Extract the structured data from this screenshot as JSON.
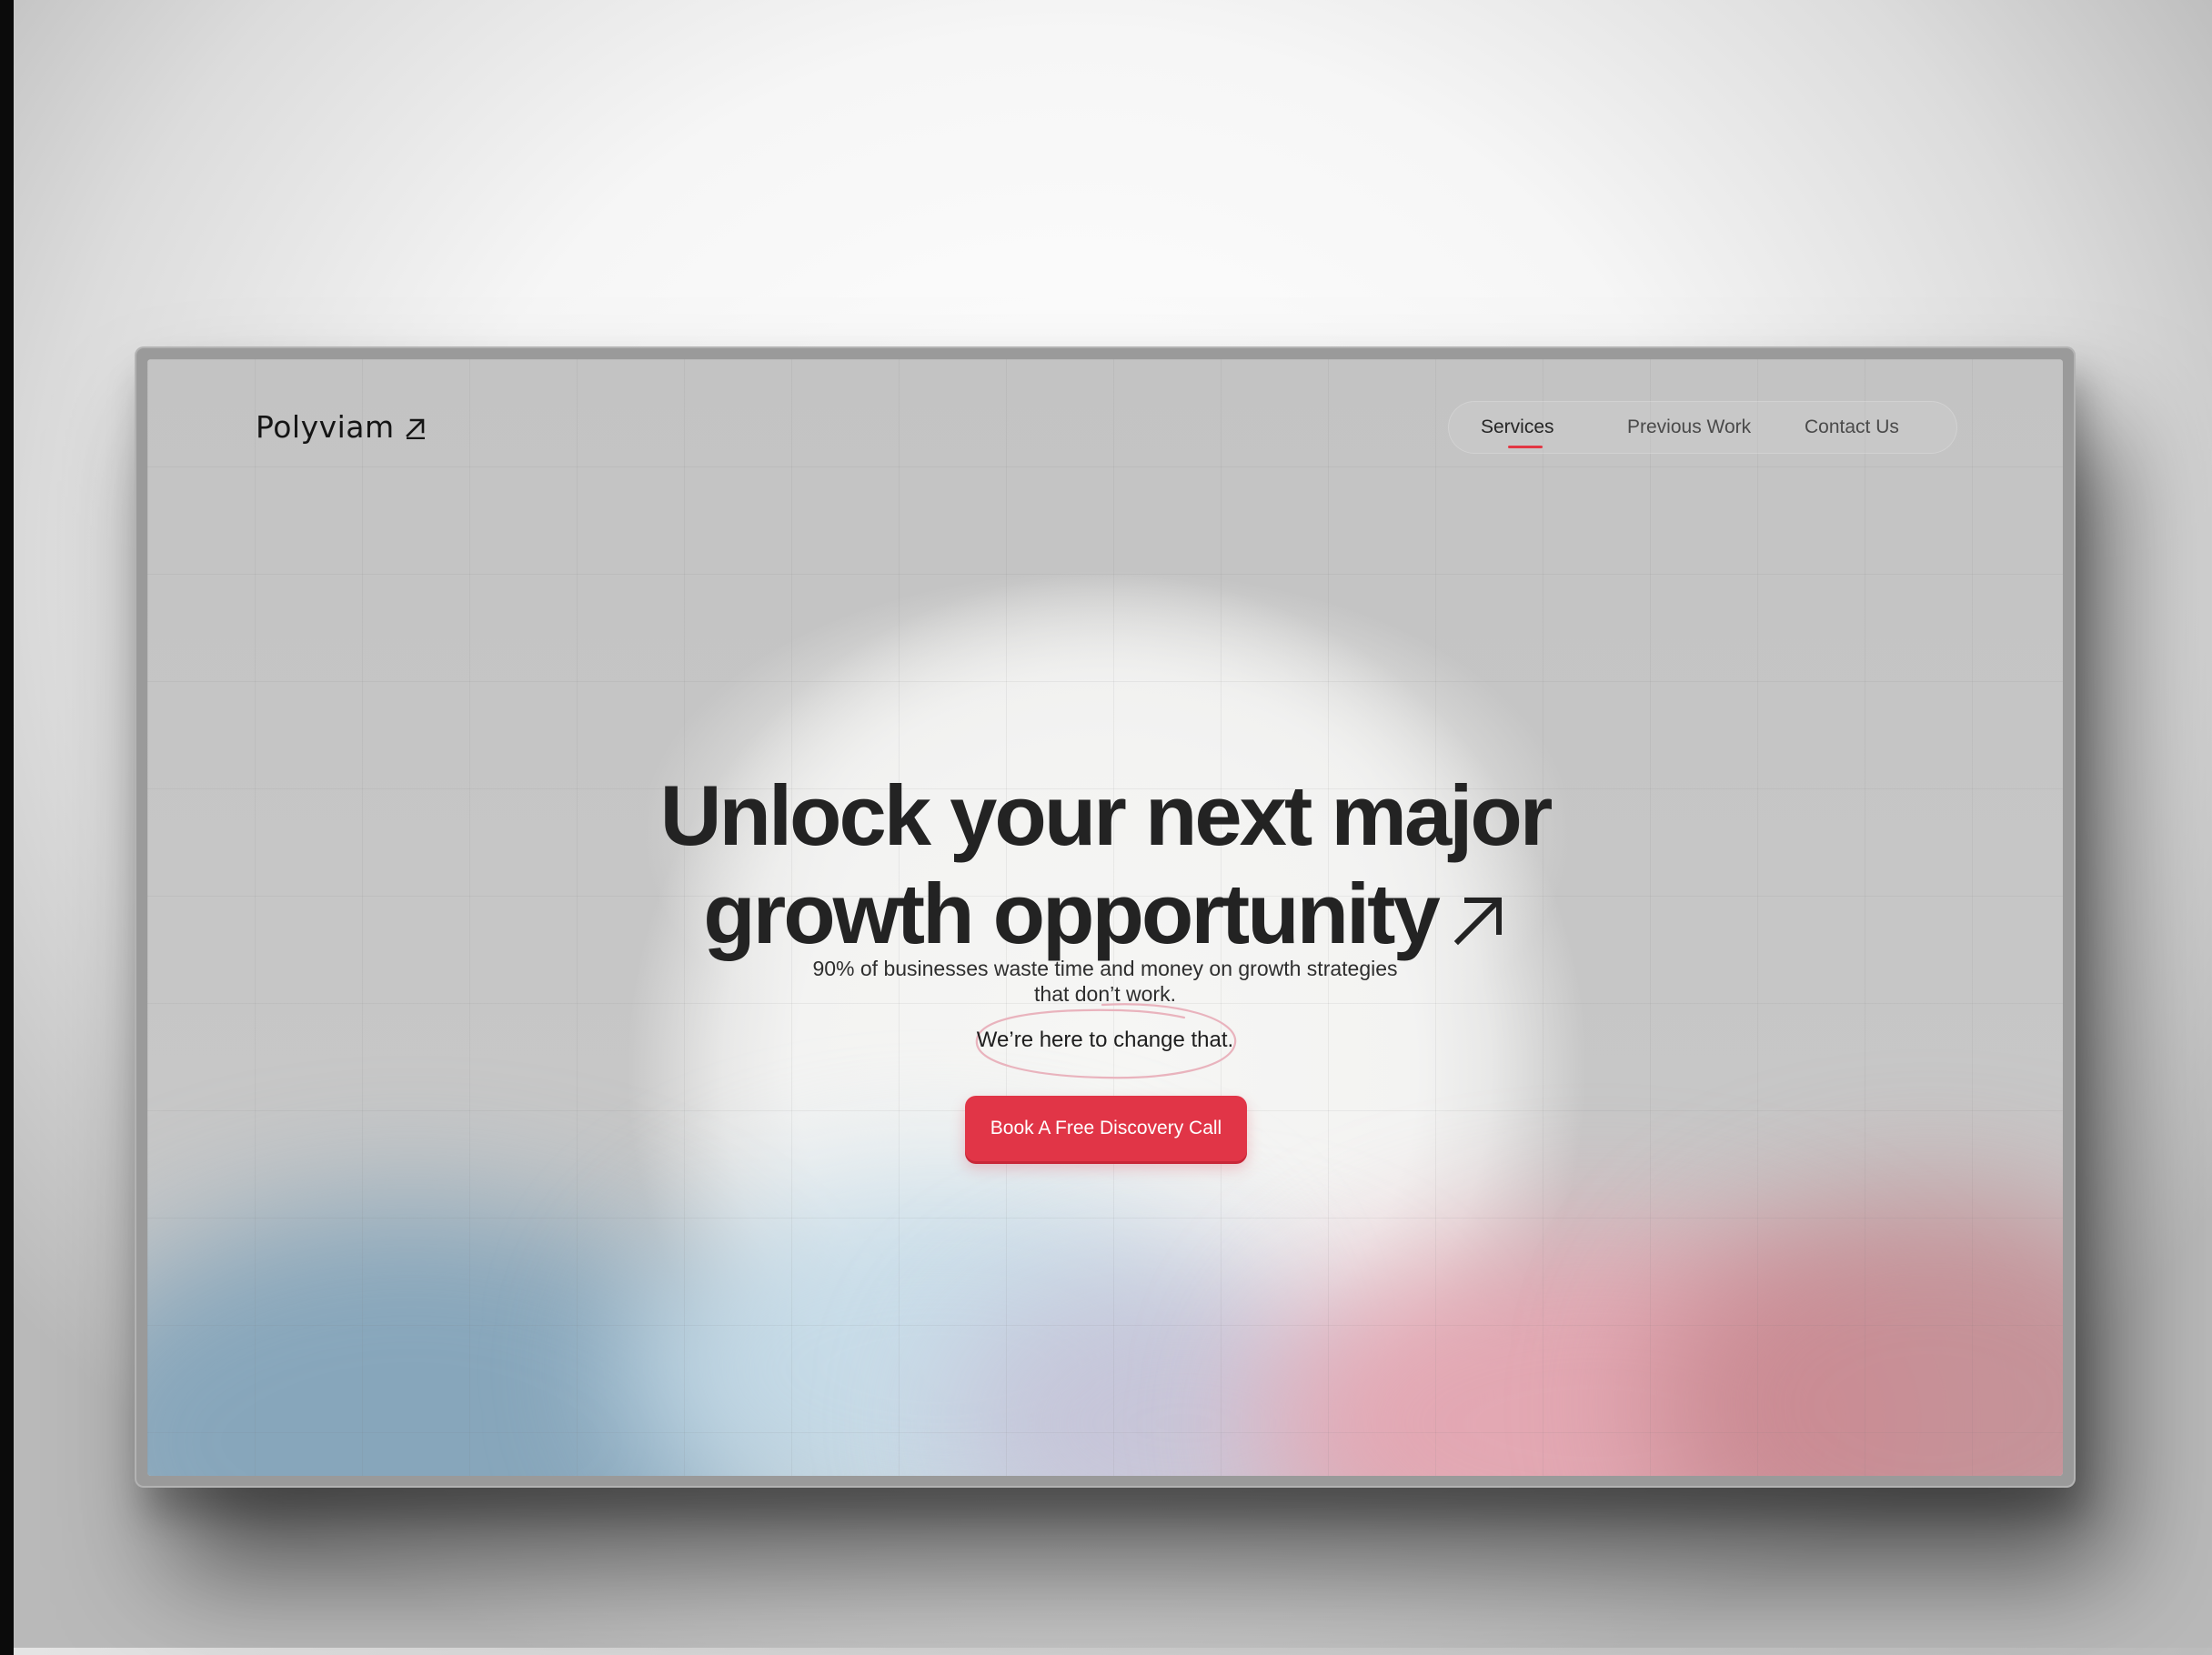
{
  "brand": {
    "name": "Polyviam",
    "logo_icon": "arrow-up-right-icon"
  },
  "nav": {
    "items": [
      {
        "label": "Services",
        "active": true
      },
      {
        "label": "Previous Work",
        "active": false
      },
      {
        "label": "Contact Us",
        "active": false
      }
    ]
  },
  "hero": {
    "title_line1": "Unlock your next major",
    "title_line2": "growth opportunity",
    "title_icon": "arrow-up-right-icon",
    "subtitle_line1": "90% of businesses waste time and money on growth strategies",
    "subtitle_line2": "that don’t work.",
    "highlight": "We’re here to change that.",
    "cta_label": "Book A Free Discovery Call"
  },
  "colors": {
    "accent": "#e13547",
    "text_dark": "#232323",
    "screen_bg": "#c6c6c6"
  }
}
